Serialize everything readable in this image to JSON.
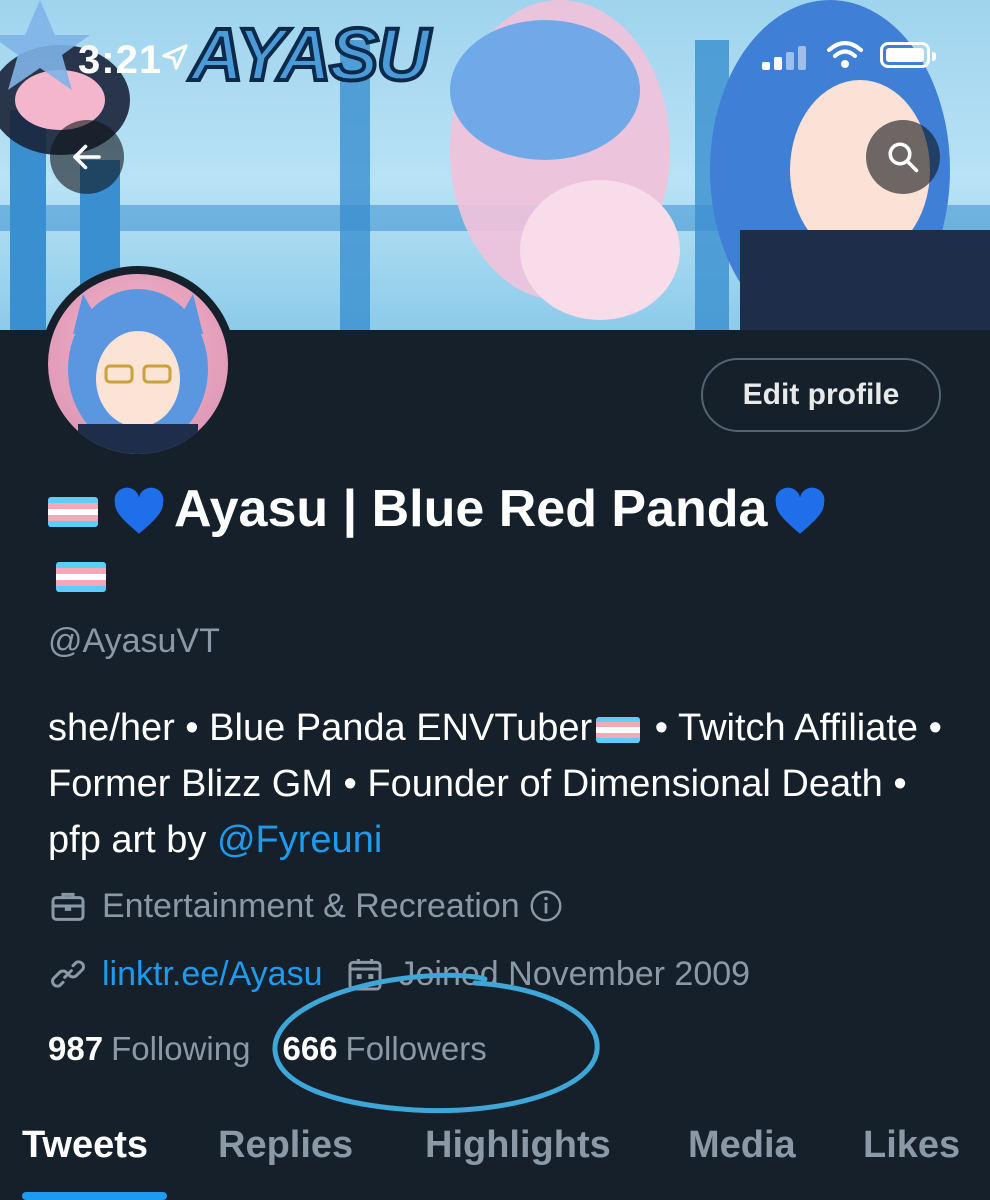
{
  "status_bar": {
    "time": "3:21",
    "logo_text": "AYASU"
  },
  "profile": {
    "display_name": "Ayasu | Blue Red Panda",
    "handle": "@AyasuVT",
    "bio_text": "she/her • Blue Panda ENVTuber",
    "bio_text_2": " • Twitch Affiliate • Former Blizz GM • Founder of Dimensional Death • pfp art by ",
    "bio_mention": "@Fyreuni",
    "category": "Entertainment & Recreation",
    "website": "linktr.ee/Ayasu",
    "joined": "Joined November 2009"
  },
  "actions": {
    "edit_profile": "Edit profile"
  },
  "stats": {
    "following_count": "987",
    "following_label": "Following",
    "followers_count": "666",
    "followers_label": "Followers"
  },
  "tabs": [
    {
      "label": "Tweets"
    },
    {
      "label": "Replies"
    },
    {
      "label": "Highlights"
    },
    {
      "label": "Media"
    },
    {
      "label": "Likes"
    }
  ],
  "colors": {
    "background": "#15202b",
    "accent": "#1d9bf0",
    "secondary_text": "#8b98a5",
    "annotation": "#3fa6d8"
  },
  "icons": [
    "location-arrow-icon",
    "wifi-icon",
    "battery-icon",
    "back-arrow-icon",
    "search-icon",
    "briefcase-icon",
    "info-icon",
    "link-icon",
    "calendar-icon",
    "trans-flag-icon",
    "blue-heart-icon"
  ]
}
